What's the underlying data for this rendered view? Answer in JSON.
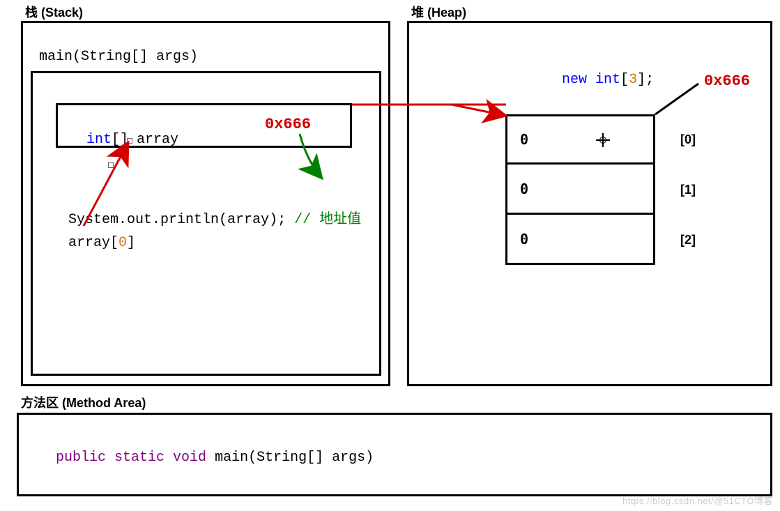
{
  "titles": {
    "stack": "栈  (Stack)",
    "heap": "堆  (Heap)",
    "method_area": "方法区  (Method Area)"
  },
  "stack": {
    "frame_header_pre": "main(String[] args)",
    "var_decl": {
      "type_kw": "int",
      "brackets": "[] ",
      "name": "array"
    },
    "addr_value": "0x666",
    "println": {
      "pre": "System.out.println(array); ",
      "slashes": "// ",
      "comment": "地址值"
    },
    "index_expr": {
      "pre": "array[",
      "idx": "0",
      "post": "]"
    }
  },
  "heap": {
    "new_expr": {
      "kw": "new ",
      "type": "int",
      "open": "[",
      "size": "3",
      "close": "];"
    },
    "address": "0x666",
    "cells": [
      {
        "value": "0",
        "index": "[0]"
      },
      {
        "value": "0",
        "index": "[1]"
      },
      {
        "value": "0",
        "index": "[2]"
      }
    ]
  },
  "method_area": {
    "signature": {
      "mods": "public static void",
      "rest": " main(String[] args)"
    }
  },
  "watermark": "https://blog.csdn.net/@51CTO博客"
}
